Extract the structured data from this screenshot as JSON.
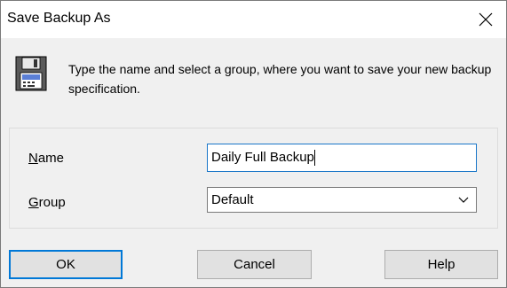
{
  "window": {
    "title": "Save Backup As",
    "close_icon": "close-icon"
  },
  "intro": {
    "icon": "floppy-disk-icon",
    "text": "Type the name and select a group, where you want to save your new backup specification."
  },
  "form": {
    "name_label_access": "N",
    "name_label_rest": "ame",
    "name_value": "Daily Full Backup",
    "group_label_access": "G",
    "group_label_rest": "roup",
    "group_value": "Default"
  },
  "buttons": {
    "ok": "OK",
    "cancel": "Cancel",
    "help": "Help"
  },
  "colors": {
    "focus_border": "#0078d7",
    "dialog_bg": "#f0f0f0"
  }
}
